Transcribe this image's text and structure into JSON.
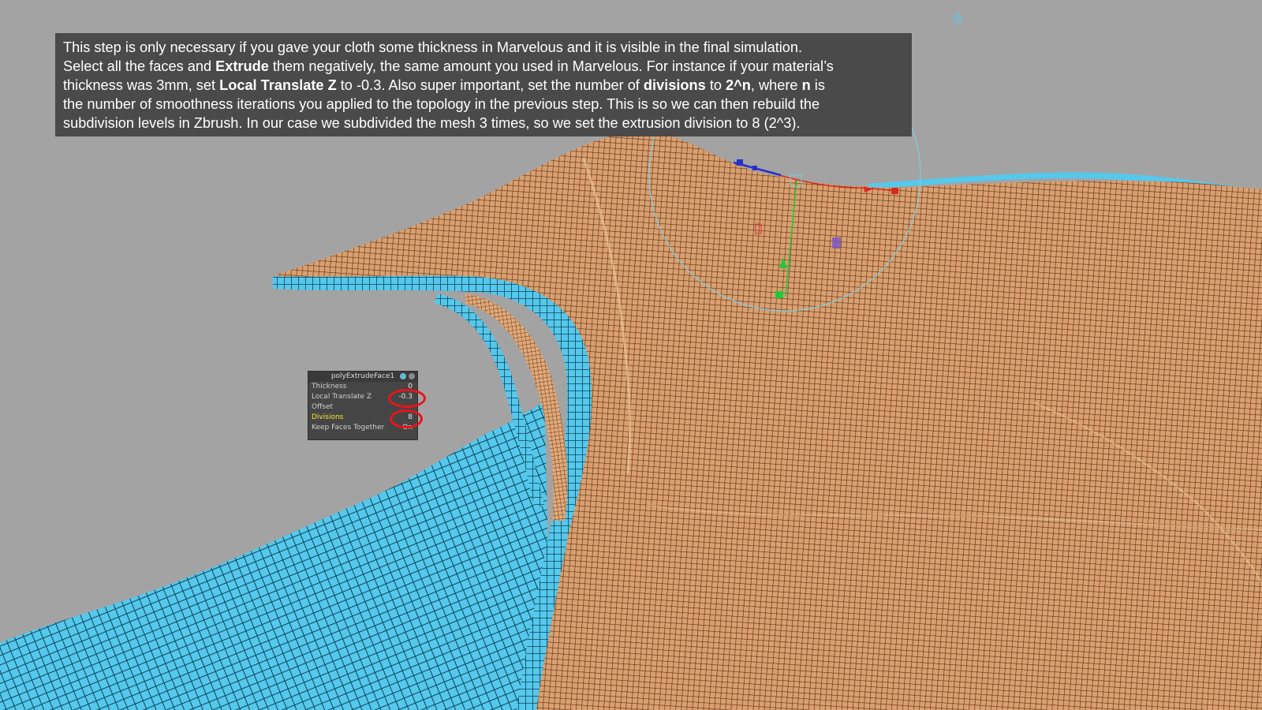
{
  "caption": {
    "s1": "This step is only necessary if you gave your cloth some thickness in Marvelous and it is visible in the final simulation.",
    "s2a": "Select all the faces and ",
    "s2b": "Extrude",
    "s2c": " them negatively, the same amount you used in Marvelous. For instance if your material’s",
    "s3a": "thickness was 3mm, set ",
    "s3b": "Local Translate Z",
    "s3c": " to -0.3. Also super important, set the number of ",
    "s3d": "divisions",
    "s3e": " to ",
    "s3f": "2^n",
    "s3g": ", where ",
    "s3h": "n",
    "s3i": " is",
    "s4": "the number of smoothness iterations you applied to the topology in the previous step. This is so we can then rebuild the",
    "s5": "subdivision levels in Zbrush. In our case we subdivided the mesh 3 times, so we set the extrusion division to 8 (2^3)."
  },
  "channel_box": {
    "title": "polyExtrudeFace1",
    "rows": [
      {
        "label": "Thickness",
        "value": "0"
      },
      {
        "label": "Local Translate Z",
        "value": "-0.3"
      },
      {
        "label": "Offset",
        "value": ""
      },
      {
        "label": "Divisions",
        "value": "8"
      },
      {
        "label": "Keep Faces Together",
        "value": "On"
      }
    ]
  },
  "colors": {
    "background": "#a3a3a3",
    "caption_bg": "#4a4a4a",
    "orange_mesh": "#dba070",
    "orange_wire": "#5c3418",
    "blue_mesh": "#55c8ec",
    "blue_wire": "#0c4458",
    "highlight_ring": "#e8141a",
    "active_channel": "#f2ec38",
    "manipulator_ring": "#7ecfe0"
  },
  "icons": {
    "pivot": "pivot-marker-icon",
    "channel_lock": "lock-dot-icon",
    "channel_close": "close-dot-icon"
  }
}
